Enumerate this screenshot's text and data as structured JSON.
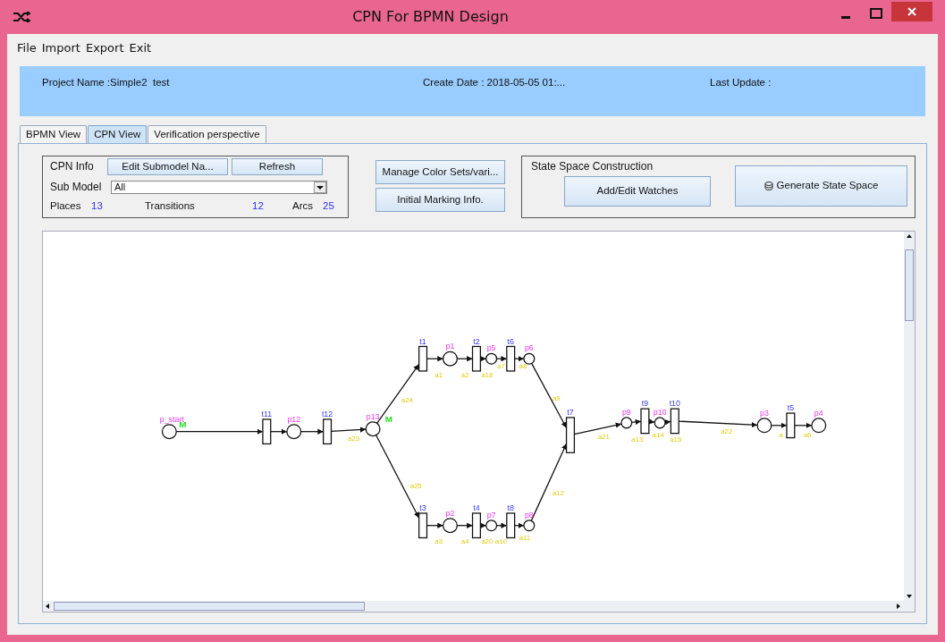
{
  "window": {
    "title": "CPN For BPMN Design"
  },
  "menu": [
    "File",
    "Import",
    "Export",
    "Exit"
  ],
  "project": {
    "name": "Project Name :Simple2  test",
    "create_date": "Create Date : 2018-05-05 01:...",
    "last_update": "Last Update :"
  },
  "tabs": [
    {
      "label": "BPMN View",
      "selected": false
    },
    {
      "label": "CPN View",
      "selected": true
    },
    {
      "label": "Verification perspective",
      "selected": false
    }
  ],
  "cpn_info": {
    "title": "CPN Info",
    "buttons": [
      "Edit Submodel Na...",
      "Refresh"
    ],
    "sub_model_label": "Sub Model",
    "sub_model_value": "All",
    "stats": [
      {
        "label": "Places",
        "value": "13"
      },
      {
        "label": "Transitions",
        "value": "12"
      },
      {
        "label": "Arcs",
        "value": "25"
      }
    ]
  },
  "middle_buttons": [
    "Manage Color Sets/vari...",
    "Initial Marking Info."
  ],
  "state_space": {
    "title": "State Space Construction",
    "buttons": [
      "Add/Edit Watches",
      "Generate State Space"
    ]
  },
  "diagram": {
    "places": [
      {
        "label": "p_start",
        "marking": "M"
      },
      {
        "label": "p12"
      },
      {
        "label": "p13",
        "marking": "M"
      },
      {
        "label": "p1"
      },
      {
        "label": "p5"
      },
      {
        "label": "p6"
      },
      {
        "label": "p2"
      },
      {
        "label": "p7"
      },
      {
        "label": "p8"
      },
      {
        "label": "p9"
      },
      {
        "label": "p10"
      },
      {
        "label": "p3"
      },
      {
        "label": "p4"
      }
    ],
    "transitions": [
      "t11",
      "t12",
      "t1",
      "t2",
      "t6",
      "t3",
      "t4",
      "t8",
      "t7",
      "t9",
      "t10",
      "t5"
    ],
    "arcs": [
      "a23",
      "a24",
      "a25",
      "a1",
      "a2",
      "a18",
      "a7",
      "a8",
      "a9",
      "a3",
      "a4",
      "a20",
      "a10",
      "a11",
      "a12",
      "a21",
      "a13",
      "a14",
      "a15",
      "a22",
      "a",
      "a6"
    ]
  }
}
